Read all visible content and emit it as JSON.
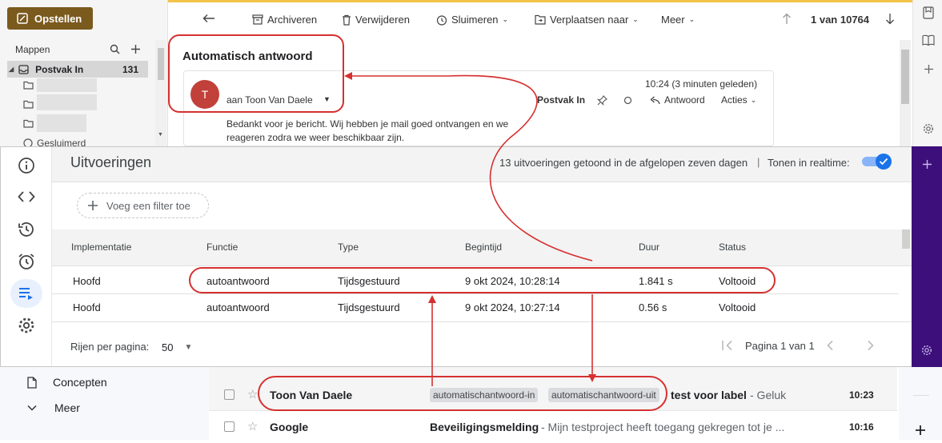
{
  "outlook": {
    "compose_label": "Opstellen",
    "folders_title": "Mappen",
    "inbox_label": "Postvak In",
    "inbox_count": "131",
    "folder_partial": "Gesluimerd",
    "toolbar": {
      "archive": "Archiveren",
      "delete": "Verwijderen",
      "snooze": "Sluimeren",
      "move": "Verplaatsen naar",
      "more": "Meer",
      "pagination": "1 van 10764"
    },
    "message": {
      "subject": "Automatisch antwoord",
      "avatar_initial": "T",
      "to": "aan Toon Van Daele",
      "time": "10:24 (3 minuten geleden)",
      "folder": "Postvak In",
      "reply": "Antwoord",
      "actions": "Acties",
      "body_line1": "Bedankt voor je bericht. Wij hebben je mail goed ontvangen en we",
      "body_line2": "reageren zodra we weer beschikbaar zijn."
    }
  },
  "apps": {
    "title": "Uitvoeringen",
    "info": "13 uitvoeringen getoond in de afgelopen zeven dagen",
    "realtime_label": "Tonen in realtime:",
    "filter_label": "Voeg een filter toe",
    "columns": [
      "Implementatie",
      "Functie",
      "Type",
      "Begintijd",
      "Duur",
      "Status"
    ],
    "rows": [
      [
        "Hoofd",
        "autoantwoord",
        "Tijdsgestuurd",
        "9 okt 2024, 10:28:14",
        "1.841 s",
        "Voltooid"
      ],
      [
        "Hoofd",
        "autoantwoord",
        "Tijdsgestuurd",
        "9 okt 2024, 10:27:14",
        "0.56 s",
        "Voltooid"
      ]
    ],
    "rows_per_page_label": "Rijen per pagina:",
    "rows_per_page": "50",
    "page_label": "Pagina 1 van 1"
  },
  "gmail": {
    "nav": [
      {
        "label": "Concepten",
        "icon": "draft-icon"
      },
      {
        "label": "Meer",
        "icon": "chevron-down-icon"
      }
    ],
    "mails": [
      {
        "sender": "Toon Van Daele",
        "labels": [
          "automatischantwoord-in",
          "automatischantwoord-uit"
        ],
        "subject": "test voor label",
        "snippet": " - Geluk",
        "time": "10:23"
      },
      {
        "sender": "Google",
        "labels": [],
        "subject": "Beveiligingsmelding",
        "snippet": " - Mijn testproject heeft toegang gekregen tot je ...",
        "time": "10:16"
      }
    ]
  },
  "colors": {
    "accent_gold": "#7b5a1e",
    "annotation_red": "#d63030",
    "toggle_blue": "#1a73e8",
    "sidebar_purple": "#3d0f7a"
  }
}
